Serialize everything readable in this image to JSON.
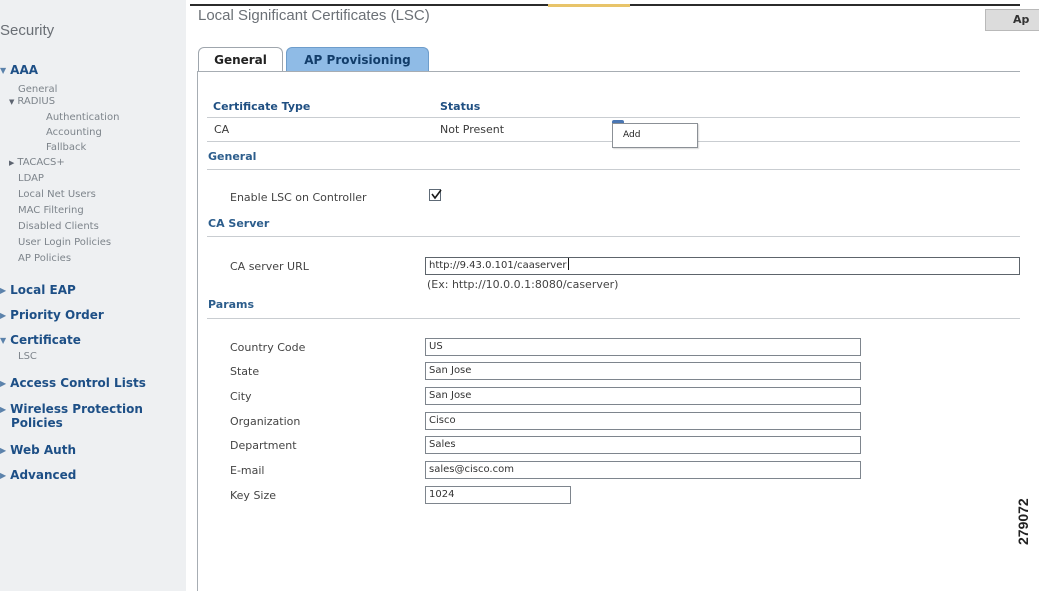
{
  "page": {
    "title": "Local Significant Certificates (LSC)",
    "apply_label": "Ap",
    "figure_id": "279072"
  },
  "sidebar": {
    "title": "Security",
    "aaa": {
      "label": "AAA",
      "items": {
        "general": "General",
        "radius": "RADIUS",
        "authentication": "Authentication",
        "accounting": "Accounting",
        "fallback": "Fallback",
        "tacacs": "TACACS+",
        "ldap": "LDAP",
        "local_net_users": "Local Net Users",
        "mac_filtering": "MAC Filtering",
        "disabled_clients": "Disabled Clients",
        "user_login_policies": "User Login Policies",
        "ap_policies": "AP Policies"
      }
    },
    "local_eap": "Local EAP",
    "priority_order": "Priority Order",
    "certificate": {
      "label": "Certificate",
      "lsc": "LSC"
    },
    "access_control_lists": "Access Control Lists",
    "wireless_protection_1": "Wireless Protection",
    "wireless_protection_2": "Policies",
    "web_auth": "Web Auth",
    "advanced": "Advanced"
  },
  "tabs": {
    "general": "General",
    "ap_provisioning": "AP Provisioning"
  },
  "cert_table": {
    "col_type": "Certificate Type",
    "col_status": "Status",
    "rows": [
      {
        "type": "CA",
        "status": "Not Present"
      }
    ],
    "add_label": "Add"
  },
  "sections": {
    "general": "General",
    "ca_server": "CA Server",
    "params": "Params"
  },
  "general": {
    "enable_lsc_label": "Enable LSC on Controller",
    "enable_lsc_checked": true
  },
  "ca_server": {
    "url_label": "CA server URL",
    "url_value": "http://9.43.0.101/caaserver",
    "url_hint": "(Ex: http://10.0.0.1:8080/caserver)"
  },
  "params": {
    "country_code": {
      "label": "Country Code",
      "value": "US"
    },
    "state": {
      "label": "State",
      "value": "San Jose"
    },
    "city": {
      "label": "City",
      "value": "San Jose"
    },
    "organization": {
      "label": "Organization",
      "value": "Cisco"
    },
    "department": {
      "label": "Department",
      "value": "Sales"
    },
    "email": {
      "label": "E-mail",
      "value": "sales@cisco.com"
    },
    "key_size": {
      "label": "Key Size",
      "value": "1024"
    }
  }
}
